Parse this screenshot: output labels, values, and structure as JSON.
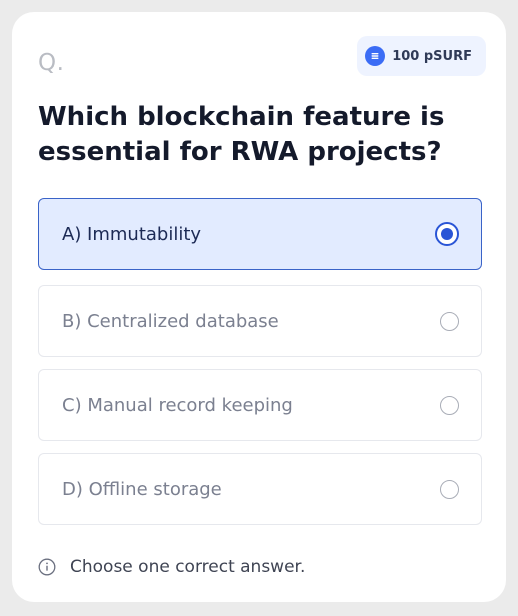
{
  "header": {
    "question_marker": "Q.",
    "reward": {
      "icon": "coin-icon",
      "label": "100 pSURF"
    }
  },
  "question": {
    "text": "Which blockchain feature is essential for RWA projects?"
  },
  "options": [
    {
      "label": "A) Immutability",
      "selected": true
    },
    {
      "label": "B) Centralized database",
      "selected": false
    },
    {
      "label": "C) Manual record keeping",
      "selected": false
    },
    {
      "label": "D) Offline storage",
      "selected": false
    }
  ],
  "hint": {
    "icon": "info-icon",
    "text": "Choose one correct answer."
  },
  "colors": {
    "accent": "#2a55d6",
    "selected_bg": "#e2ebff",
    "badge_bg": "#eef3ff",
    "card_bg": "#ffffff",
    "page_bg": "#ebebeb"
  }
}
